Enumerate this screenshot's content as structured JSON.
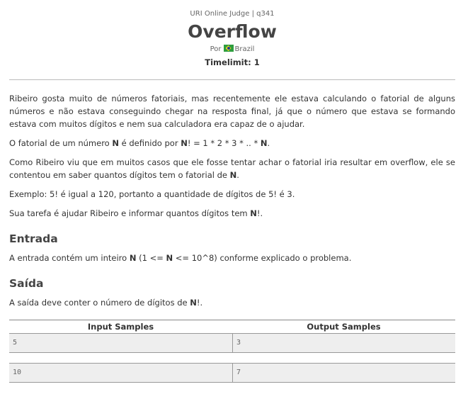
{
  "header": {
    "judge": "URI Online Judge | q341",
    "title": "Overflow",
    "author_prefix": "Por",
    "country": "Brazil",
    "timelimit": "Timelimit: 1"
  },
  "description": {
    "p1": "Ribeiro gosta muito de números fatoriais, mas recentemente ele estava calculando o fatorial de alguns números e não estava conseguindo chegar na resposta final, já que o número que estava se formando estava com muitos dígitos e nem sua calculadora era capaz de o ajudar.",
    "p2_text": "O fatorial de um número ",
    "p2_n1": "N",
    "p2_mid1": " é definido por ",
    "p2_n2": "N",
    "p2_mid2": "! = 1 * 2 * 3 * .. * ",
    "p2_n3": "N",
    "p2_end": ".",
    "p3_text": "Como Ribeiro viu que em muitos casos que ele fosse tentar achar o fatorial iria resultar em overflow, ele se contentou em saber quantos dígitos tem o fatorial de ",
    "p3_n": "N",
    "p3_end": ".",
    "p4": "Exemplo: 5! é igual a 120, portanto a quantidade de dígitos de 5! é 3.",
    "p5_text": "Sua tarefa é ajudar Ribeiro e informar quantos dígitos tem ",
    "p5_n": "N",
    "p5_end": "!."
  },
  "input_section": {
    "title": "Entrada",
    "text_a": "A entrada contém um inteiro ",
    "n1": "N",
    "text_b": " (1 <= ",
    "n2": "N",
    "text_c": " <= 10^8) conforme explicado o problema."
  },
  "output_section": {
    "title": "Saída",
    "text_a": "A saída deve conter o número de dígitos de ",
    "n": "N",
    "text_b": "!."
  },
  "samples": {
    "input_header": "Input Samples",
    "output_header": "Output Samples",
    "rows": [
      {
        "input": "5",
        "output": "3"
      },
      {
        "input": "10",
        "output": "7"
      }
    ]
  },
  "colors": {
    "flag_green": "#2e9e3e",
    "flag_yellow": "#f4d21d",
    "flag_blue": "#24408f",
    "sample_bg": "#eeeeee"
  }
}
